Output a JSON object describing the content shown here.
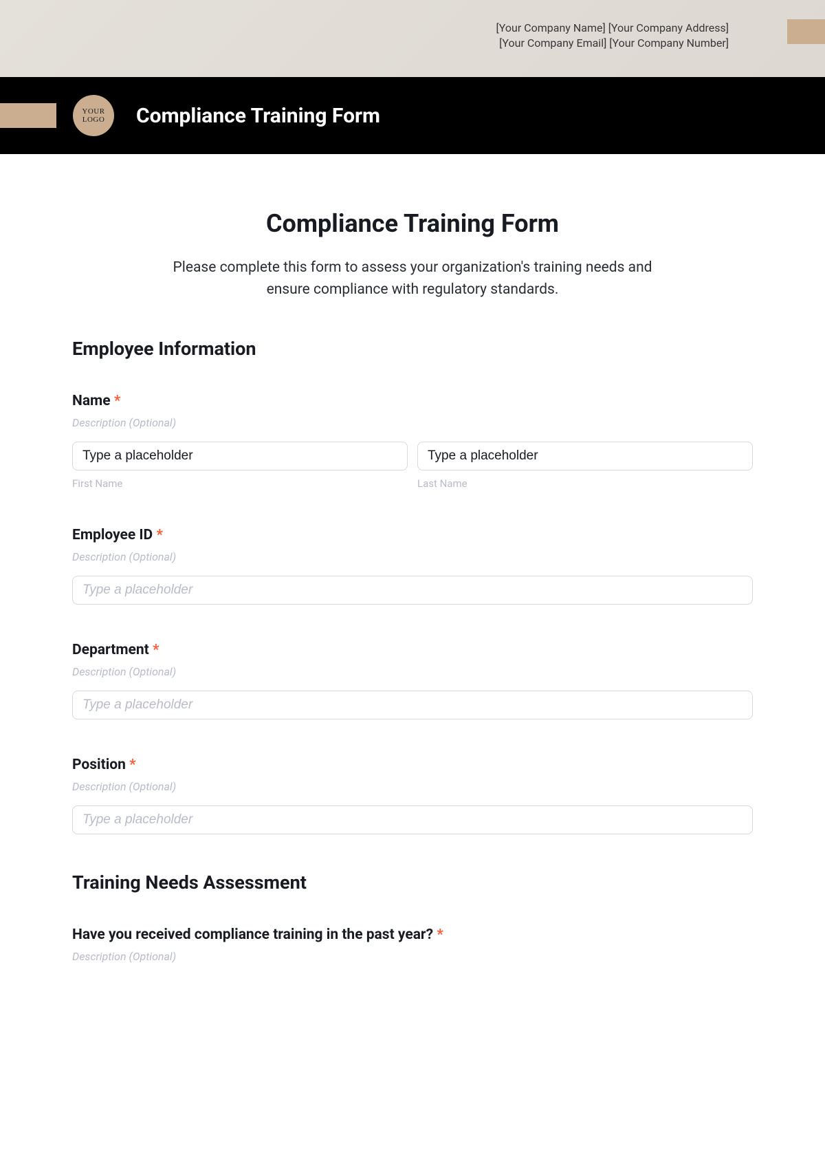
{
  "header": {
    "company_line1": "[Your Company Name] [Your Company Address]",
    "company_line2": "[Your Company Email] [Your Company Number]",
    "logo_line1": "YOUR",
    "logo_line2": "LOGO",
    "bar_title": "Compliance Training Form"
  },
  "form": {
    "title": "Compliance Training Form",
    "intro": "Please complete this form to assess your organization's training needs and ensure compliance with regulatory standards.",
    "section1": "Employee Information",
    "section2": "Training Needs Assessment",
    "name": {
      "label": "Name",
      "req": "*",
      "desc": "Description (Optional)",
      "first_placeholder": "Type a placeholder",
      "first_sub": "First Name",
      "last_placeholder": "Type a placeholder",
      "last_sub": "Last Name"
    },
    "employee_id": {
      "label": "Employee ID",
      "req": "*",
      "desc": "Description (Optional)",
      "placeholder": "Type a placeholder"
    },
    "department": {
      "label": "Department",
      "req": "*",
      "desc": "Description (Optional)",
      "placeholder": "Type a placeholder"
    },
    "position": {
      "label": "Position",
      "req": "*",
      "desc": "Description (Optional)",
      "placeholder": "Type a placeholder"
    },
    "training_q": {
      "label": "Have you received compliance training in the past year?",
      "req": "*",
      "desc": "Description (Optional)"
    }
  }
}
